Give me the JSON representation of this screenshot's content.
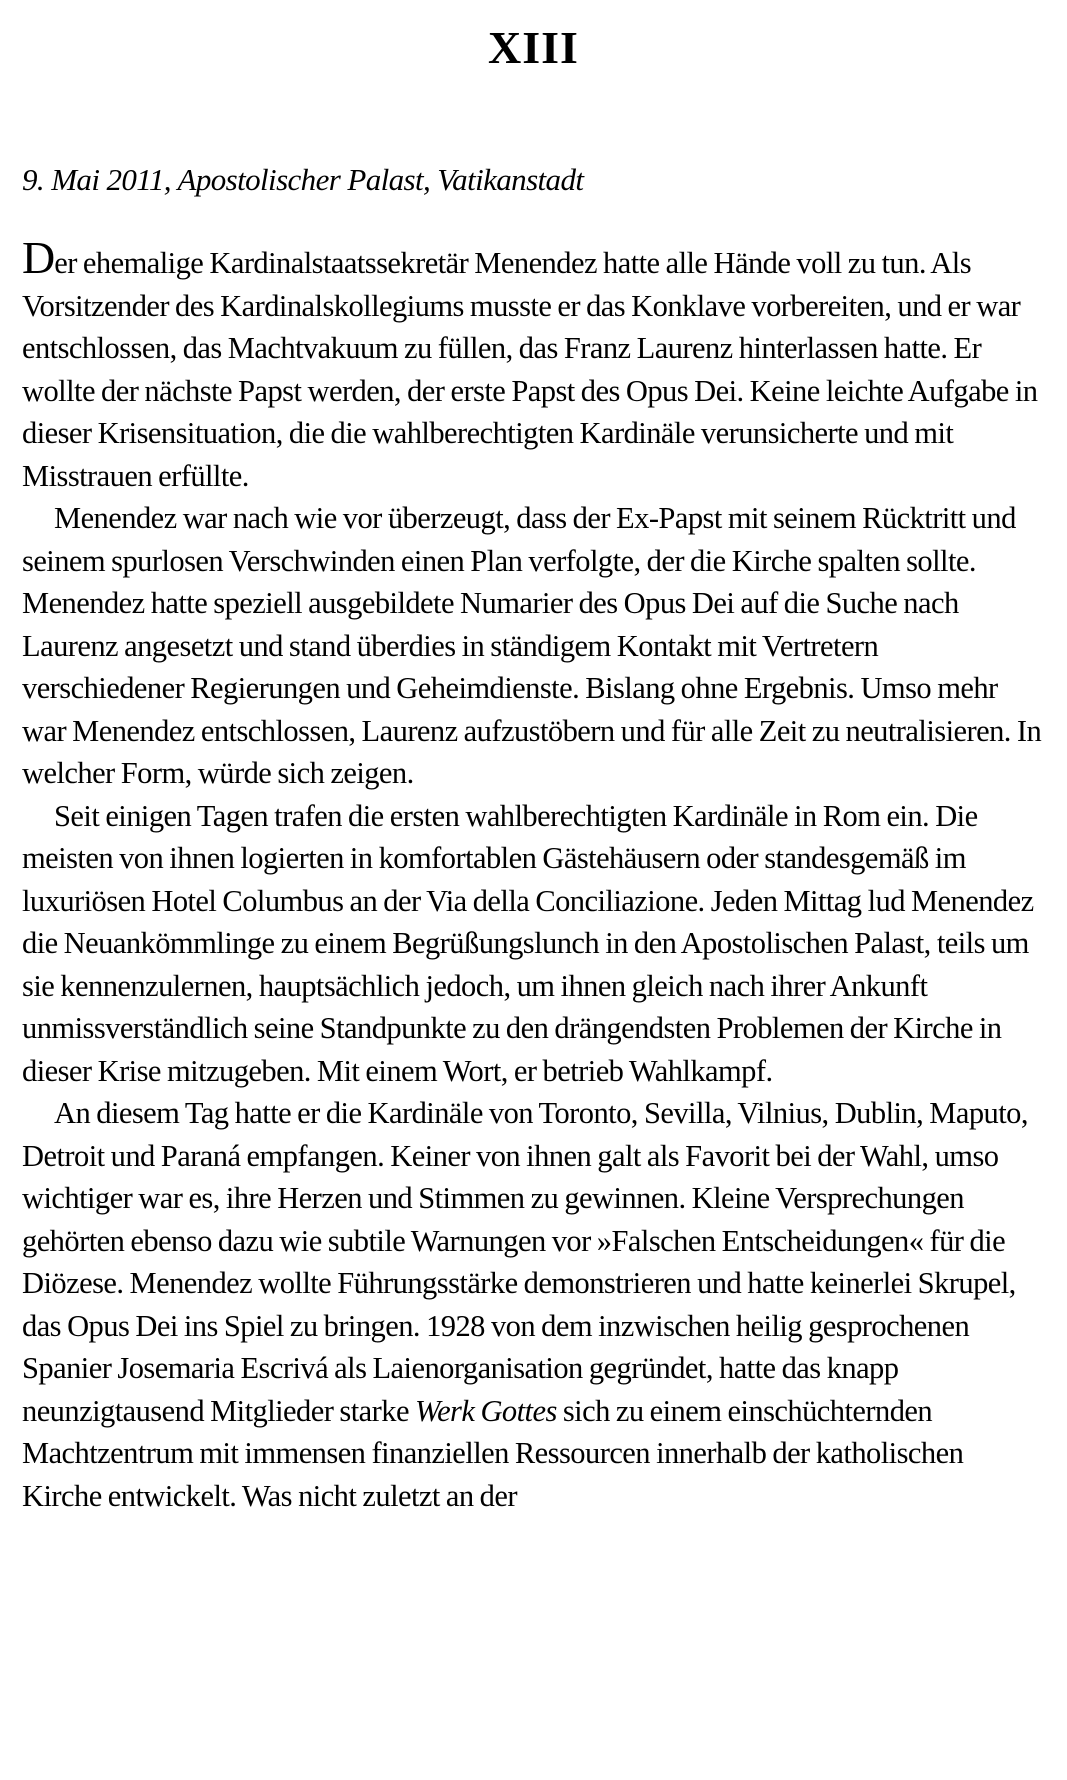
{
  "chapter": {
    "number": "XIII"
  },
  "dateline": "9. Mai 2011, Apostolischer Palast, Vatikanstadt",
  "paragraphs": [
    {
      "initial": "D",
      "text": "er ehemalige Kardinalstaatssekretär Menendez hatte alle Hände voll zu tun. Als Vorsitzender des Kardinalskollegiums musste er das Konklave vorbereiten, und er war entschlossen, das Machtvakuum zu füllen, das Franz Laurenz hinterlassen hatte. Er wollte der nächste Papst werden, der erste Papst des Opus Dei. Keine leichte Aufgabe in dieser Krisensituation, die die wahlberechtigten Kardinäle verunsicherte und mit Misstrauen erfüllte."
    },
    {
      "text": "Menendez war nach wie vor überzeugt, dass der Ex-Papst mit seinem Rücktritt und seinem spurlosen Verschwinden einen Plan verfolgte, der die Kirche spalten sollte. Menendez hatte speziell ausgebildete Numarier des Opus Dei auf die Suche nach Laurenz angesetzt und stand überdies in ständigem Kontakt mit Vertretern verschiedener Regierungen und Geheimdienste. Bislang ohne Ergebnis. Umso mehr war Menendez entschlossen, Laurenz aufzustöbern und für alle Zeit zu neutralisieren. In welcher Form, würde sich zeigen."
    },
    {
      "text": "Seit einigen Tagen trafen die ersten wahlberechtigten Kardinäle in Rom ein. Die meisten von ihnen logierten in komfortablen Gästehäusern oder standesgemäß im luxuriösen Hotel Columbus an der Via della Conciliazione. Jeden Mittag lud Menendez die Neuankömmlinge zu einem Begrüßungslunch in den Apostolischen Palast, teils um sie kennenzulernen, hauptsächlich jedoch, um ihnen gleich nach ihrer Ankunft unmissverständlich seine Standpunkte zu den drängendsten Problemen der Kirche in dieser Krise mitzugeben. Mit einem Wort, er betrieb Wahlkampf."
    },
    {
      "text_before": "An diesem Tag hatte er die Kardinäle von Toronto, Sevilla, Vilnius, Dublin, Maputo, Detroit und Paraná empfangen. Keiner von ihnen galt als Favorit bei der Wahl, umso wichtiger war es, ihre Herzen und Stimmen zu gewinnen. Kleine Versprechungen gehörten ebenso dazu wie subtile Warnungen vor »Falschen Entscheidungen« für die Diözese. Menendez wollte Führungsstärke demonstrieren und hatte keinerlei Skrupel, das Opus Dei ins Spiel zu bringen. 1928 von dem inzwischen heilig gesprochenen Spanier Josemaria Escrivá als Laienorganisation gegründet, hatte das knapp neunzigtausend Mitglieder starke ",
      "emphasis": "Werk Gottes",
      "text_after": " sich zu einem einschüchternden Machtzentrum mit immensen finanziellen Ressourcen innerhalb der katholischen Kirche entwickelt. Was nicht zuletzt an der"
    }
  ]
}
